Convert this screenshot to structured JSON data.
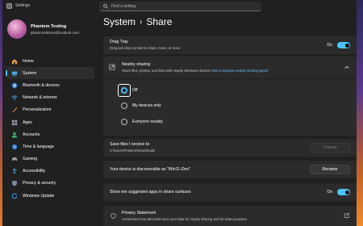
{
  "window": {
    "title": "Settings"
  },
  "search": {
    "placeholder": "Find a setting"
  },
  "user": {
    "name": "Phantom Testing",
    "email": "phantomdemos@outlook.com"
  },
  "sidebar": {
    "items": [
      {
        "label": "Home",
        "icon": "home-icon",
        "active": false
      },
      {
        "label": "System",
        "icon": "system-icon",
        "active": true
      },
      {
        "label": "Bluetooth & devices",
        "icon": "bluetooth-icon",
        "active": false
      },
      {
        "label": "Network & internet",
        "icon": "network-icon",
        "active": false
      },
      {
        "label": "Personalization",
        "icon": "brush-icon",
        "active": false
      },
      {
        "label": "Apps",
        "icon": "apps-icon",
        "active": false
      },
      {
        "label": "Accounts",
        "icon": "accounts-icon",
        "active": false
      },
      {
        "label": "Time & language",
        "icon": "globe-clock-icon",
        "active": false
      },
      {
        "label": "Gaming",
        "icon": "gaming-icon",
        "active": false
      },
      {
        "label": "Accessibility",
        "icon": "accessibility-icon",
        "active": false
      },
      {
        "label": "Privacy & security",
        "icon": "shield-icon",
        "active": false
      },
      {
        "label": "Windows Update",
        "icon": "update-icon",
        "active": false
      }
    ]
  },
  "header": {
    "parent": "System",
    "separator": "›",
    "current": "Share"
  },
  "drag_tray": {
    "title": "Drag Tray",
    "subtitle": "Drag and drop content to share, move, or more",
    "state": "On"
  },
  "nearby_sharing": {
    "title": "Nearby sharing",
    "subtitle": "Share files, photos, and links with nearby Windows devices",
    "link": "How to improve nearby sharing speed",
    "options": [
      "Off",
      "My devices only",
      "Everyone nearby"
    ],
    "selected": "Off"
  },
  "save_files": {
    "title": "Save files I receive to",
    "path": "C:\\Users\\Phantom\\Downloads",
    "button": "Change"
  },
  "discoverable": {
    "text": "Your device is discoverable as \"Win11-Dev\"",
    "button": "Rename"
  },
  "suggested_apps": {
    "title": "Show me suggested apps in share surfaces",
    "state": "On"
  },
  "privacy": {
    "title": "Privacy Statement",
    "subtitle": "Understand how Microsoft uses your data for nearby sharing and for what purposes"
  },
  "colors": {
    "accent": "#4cc2ff",
    "background": "#202020",
    "card": "#2b2b2b"
  }
}
